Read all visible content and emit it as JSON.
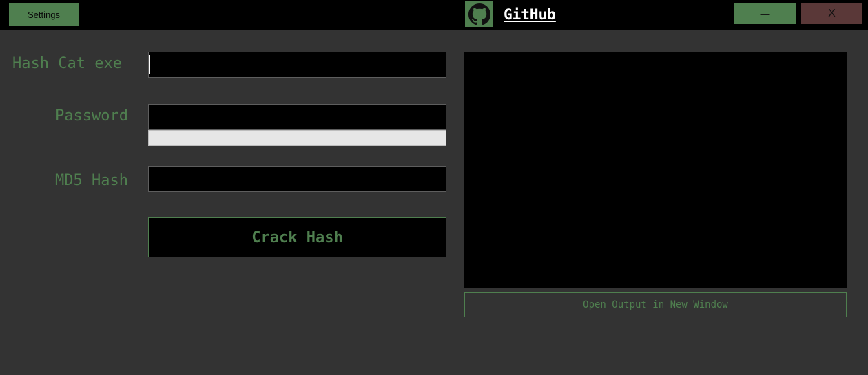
{
  "titlebar": {
    "settings_label": "Settings",
    "github_label": "GitHub",
    "github_icon": "github-octocat-icon",
    "minimize_label": "—",
    "close_label": "X"
  },
  "form": {
    "hashcat_label": "Hash Cat exe",
    "hashcat_value": "",
    "password_label": "Password",
    "password_value": "",
    "password_strength_percent": 0,
    "md5_label": "MD5 Hash",
    "md5_value": "",
    "crack_label": "Crack Hash"
  },
  "output": {
    "text": "",
    "open_new_window_label": "Open Output in New Window"
  },
  "colors": {
    "background": "#333333",
    "titlebar": "#000000",
    "accent_green": "#4f7f4f",
    "close_red": "#5a3838",
    "input_bg": "#000000",
    "strength_bar_bg": "#e6e6e6"
  }
}
